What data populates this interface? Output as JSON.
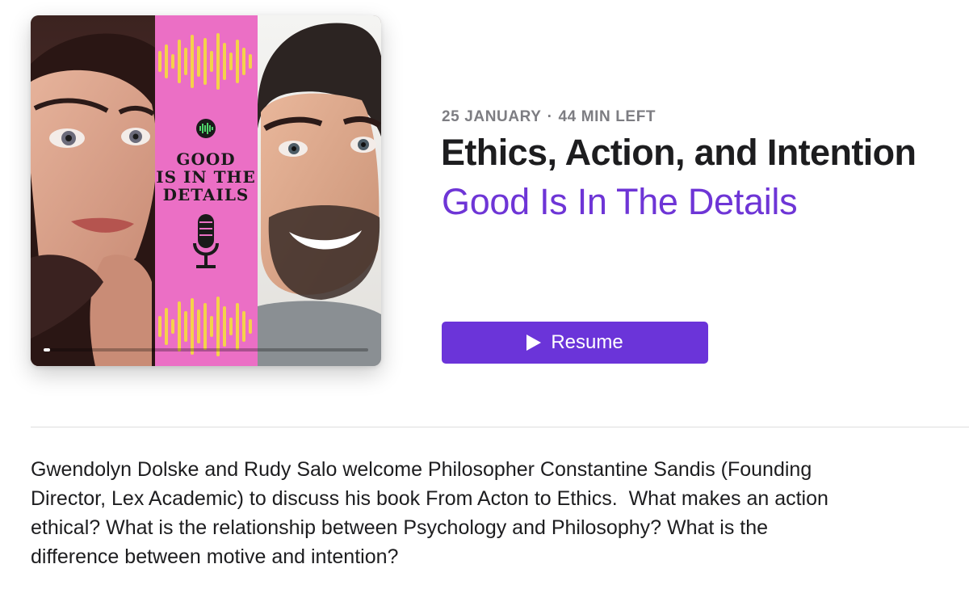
{
  "artwork": {
    "title_lines": [
      "GOOD",
      "IS IN THE",
      "DETAILS"
    ],
    "panel_color": "#eb6fc5",
    "wave_color": "#f5d24a",
    "icon": "microphone-icon",
    "badge_icon": "soundwave-icon",
    "progress": 0.02
  },
  "episode": {
    "date": "25 JANUARY",
    "separator": "·",
    "time_left": "44 MIN LEFT",
    "title": "Ethics, Action, and Intention",
    "show": "Good Is In The Details",
    "show_color": "#6e35d6"
  },
  "actions": {
    "resume_label": "Resume",
    "resume_color": "#6b34d9",
    "resume_icon": "play-icon"
  },
  "description": "Gwendolyn Dolske and Rudy Salo welcome Philosopher Constantine Sandis (Founding Director, Lex Academic) to discuss his book From Acton to Ethics.  What makes an action ethical? What is the relationship between Psychology and Philosophy? What is the difference between motive and intention?"
}
